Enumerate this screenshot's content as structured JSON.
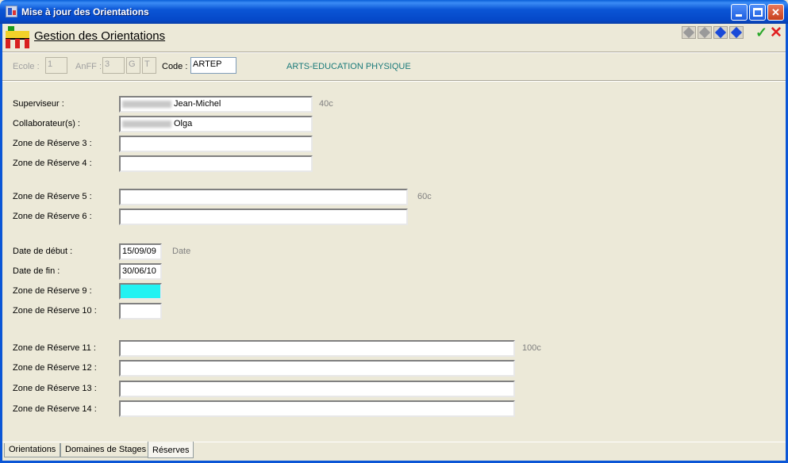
{
  "window": {
    "title": "Mise à jour des Orientations"
  },
  "header": {
    "title": "Gestion des Orientations"
  },
  "keys": {
    "ecole_label": "Ecole :",
    "ecole_value": "1",
    "anff_label": "AnFF :",
    "anff_value": "3",
    "g_value": "G",
    "t_value": "T",
    "code_label": "Code :",
    "code_value": "ARTEP",
    "code_description": "ARTS-EDUCATION PHYSIQUE"
  },
  "form": {
    "superviseur_label": "Superviseur :",
    "superviseur_value": "Jean-Michel",
    "collaborateur_label": "Collaborateur(s) :",
    "collaborateur_value": "Olga",
    "r3_label": "Zone de Réserve 3 :",
    "r4_label": "Zone de Réserve 4 :",
    "hint_40": "40c",
    "r5_label": "Zone de Réserve 5 :",
    "r6_label": "Zone de Réserve 6 :",
    "hint_60": "60c",
    "date_debut_label": "Date de début :",
    "date_debut_value": "15/09/09",
    "date_fin_label": "Date de fin :",
    "date_fin_value": "30/06/10",
    "hint_date": "Date",
    "r9_label": "Zone de Réserve 9 :",
    "r10_label": "Zone de Réserve 10 :",
    "r11_label": "Zone de Réserve 11 :",
    "r12_label": "Zone de Réserve 12 :",
    "r13_label": "Zone de Réserve 13 :",
    "r14_label": "Zone de Réserve 14 :",
    "hint_100": "100c"
  },
  "tabs": [
    {
      "label": "Orientations"
    },
    {
      "label": "Domaines de Stages"
    },
    {
      "label": "Réserves"
    }
  ],
  "colors": {
    "focused_field": "#22f2f2",
    "code_description": "#1a7a7a",
    "titlebar": "#0b56d6"
  }
}
